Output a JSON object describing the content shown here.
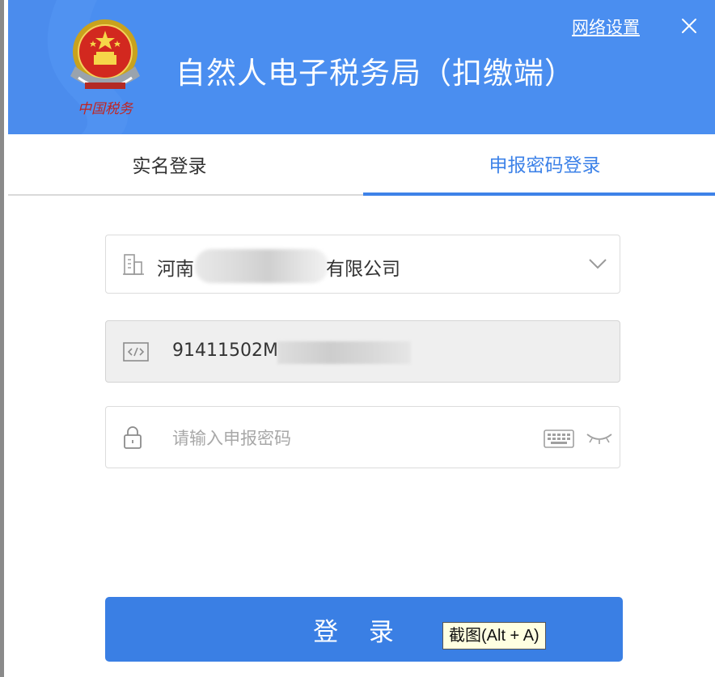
{
  "header": {
    "app_title": "自然人电子税务局（扣缴端）",
    "network_settings": "网络设置",
    "emblem_caption": "中国税务",
    "close_icon": "close-icon"
  },
  "tabs": [
    {
      "label": "实名登录",
      "active": false
    },
    {
      "label": "申报密码登录",
      "active": true
    }
  ],
  "form": {
    "company": {
      "prefix": "河南",
      "suffix": "有限公司",
      "icon": "building-icon",
      "dropdown_icon": "chevron-down-icon"
    },
    "tax_id": {
      "visible_value": "91411502M",
      "icon": "code-icon"
    },
    "password": {
      "placeholder": "请输入申报密码",
      "icon": "lock-icon",
      "keyboard_icon": "keyboard-icon",
      "eye_icon": "eye-closed-icon"
    },
    "login_label": "登 录"
  },
  "tooltip": {
    "text": "截图(Alt + A)"
  },
  "colors": {
    "header_bg": "#4a8ef0",
    "accent": "#3d82e8",
    "button": "#3a7fe4"
  }
}
